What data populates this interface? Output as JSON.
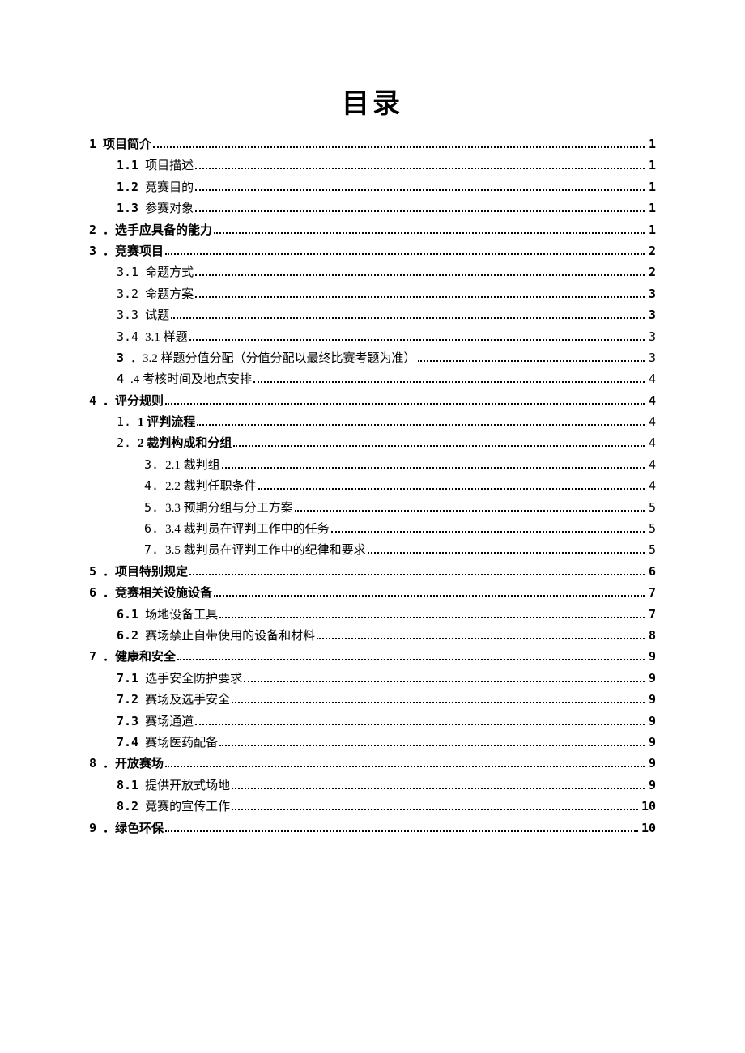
{
  "title": "目录",
  "entries": [
    {
      "level": 0,
      "num": "1",
      "numBold": true,
      "label": "项目简介",
      "labelBold": true,
      "page": "1",
      "pageBold": true
    },
    {
      "level": 1,
      "num": "1.1",
      "numBold": true,
      "label": "项目描述",
      "labelBold": false,
      "page": "1",
      "pageBold": true
    },
    {
      "level": 1,
      "num": "1.2",
      "numBold": true,
      "label": "竞赛目的",
      "labelBold": false,
      "page": "1",
      "pageBold": true
    },
    {
      "level": 1,
      "num": "1.3",
      "numBold": true,
      "label": "参赛对象",
      "labelBold": false,
      "page": "1",
      "pageBold": true
    },
    {
      "level": 0,
      "num": "2",
      "numBold": true,
      "label": "．选手应具备的能力",
      "labelBold": true,
      "page": "1",
      "pageBold": true
    },
    {
      "level": 0,
      "num": "3",
      "numBold": true,
      "label": "．竞赛项目",
      "labelBold": true,
      "page": "2",
      "pageBold": true
    },
    {
      "level": 1,
      "num": "3.1",
      "numBold": false,
      "label": "命题方式",
      "labelBold": false,
      "page": "2",
      "pageBold": true
    },
    {
      "level": 1,
      "num": "3.2",
      "numBold": false,
      "label": "命题方案",
      "labelBold": false,
      "page": "3",
      "pageBold": true
    },
    {
      "level": 1,
      "num": "3.3",
      "numBold": false,
      "label": "试题",
      "labelBold": false,
      "page": "3",
      "pageBold": true
    },
    {
      "level": 1,
      "num": "3.4",
      "numBold": false,
      "label": "3.1 样题",
      "labelBold": false,
      "page": "3",
      "pageBold": false
    },
    {
      "level": 1,
      "num": "3",
      "numBold": true,
      "label": "．3.2 样题分值分配（分值分配以最终比赛考题为准）",
      "labelBold": false,
      "page": "3",
      "pageBold": false
    },
    {
      "level": 1,
      "num": "4",
      "numBold": true,
      "label": ".4 考核时间及地点安排",
      "labelBold": false,
      "page": "4",
      "pageBold": false
    },
    {
      "level": 0,
      "num": "4",
      "numBold": true,
      "label": "．评分规则",
      "labelBold": true,
      "page": "4",
      "pageBold": true
    },
    {
      "level": 1,
      "num": "1.",
      "numBold": false,
      "label": "1 评判流程",
      "labelBold": true,
      "page": "4",
      "pageBold": false
    },
    {
      "level": 1,
      "num": "2.",
      "numBold": false,
      "label": "2 裁判构成和分组",
      "labelBold": true,
      "page": "4",
      "pageBold": false
    },
    {
      "level": 2,
      "num": "3.",
      "numBold": false,
      "label": "2.1 裁判组",
      "labelBold": false,
      "page": "4",
      "pageBold": false
    },
    {
      "level": 2,
      "num": "4.",
      "numBold": false,
      "label": "2.2 裁判任职条件",
      "labelBold": false,
      "page": "4",
      "pageBold": false
    },
    {
      "level": 2,
      "num": "5.",
      "numBold": false,
      "label": "3.3 预期分组与分工方案",
      "labelBold": false,
      "page": "5",
      "pageBold": false
    },
    {
      "level": 2,
      "num": "6.",
      "numBold": false,
      "label": "3.4 裁判员在评判工作中的任务",
      "labelBold": false,
      "page": "5",
      "pageBold": false
    },
    {
      "level": 2,
      "num": "7.",
      "numBold": false,
      "label": "3.5 裁判员在评判工作中的纪律和要求",
      "labelBold": false,
      "page": "5",
      "pageBold": false
    },
    {
      "level": 0,
      "num": "5",
      "numBold": true,
      "label": "．项目特别规定",
      "labelBold": true,
      "page": "6",
      "pageBold": true
    },
    {
      "level": 0,
      "num": "6",
      "numBold": true,
      "label": "．竞赛相关设施设备",
      "labelBold": true,
      "page": "7",
      "pageBold": true
    },
    {
      "level": 1,
      "num": "6.1",
      "numBold": true,
      "label": "场地设备工具",
      "labelBold": false,
      "page": "7",
      "pageBold": true
    },
    {
      "level": 1,
      "num": "6.2",
      "numBold": true,
      "label": "赛场禁止自带使用的设备和材料",
      "labelBold": false,
      "page": "8",
      "pageBold": true
    },
    {
      "level": 0,
      "num": "7",
      "numBold": true,
      "label": "．健康和安全",
      "labelBold": true,
      "page": "9",
      "pageBold": true
    },
    {
      "level": 1,
      "num": "7.1",
      "numBold": true,
      "label": "选手安全防护要求",
      "labelBold": false,
      "page": "9",
      "pageBold": true
    },
    {
      "level": 1,
      "num": "7.2",
      "numBold": true,
      "label": "赛场及选手安全",
      "labelBold": false,
      "page": "9",
      "pageBold": true
    },
    {
      "level": 1,
      "num": "7.3",
      "numBold": true,
      "label": "赛场通道",
      "labelBold": false,
      "page": "9",
      "pageBold": true
    },
    {
      "level": 1,
      "num": "7.4",
      "numBold": true,
      "label": "赛场医药配备",
      "labelBold": false,
      "page": "9",
      "pageBold": true
    },
    {
      "level": 0,
      "num": "8",
      "numBold": true,
      "label": "．开放赛场",
      "labelBold": true,
      "page": "9",
      "pageBold": true
    },
    {
      "level": 1,
      "num": "8.1",
      "numBold": true,
      "label": "提供开放式场地",
      "labelBold": false,
      "page": "9",
      "pageBold": true
    },
    {
      "level": 1,
      "num": "8.2",
      "numBold": true,
      "label": "竞赛的宣传工作",
      "labelBold": false,
      "page": "10",
      "pageBold": true
    },
    {
      "level": 0,
      "num": "9",
      "numBold": true,
      "label": "．绿色环保",
      "labelBold": true,
      "page": "10",
      "pageBold": true
    }
  ]
}
